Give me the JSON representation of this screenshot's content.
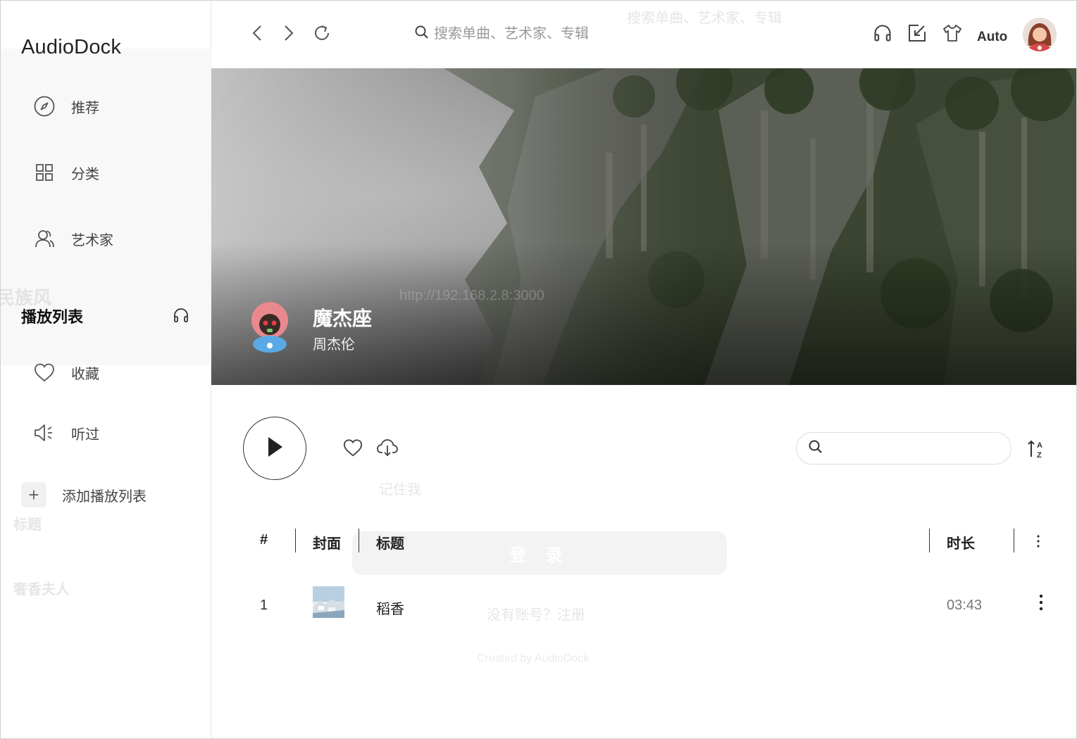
{
  "app": {
    "name": "AudioDock"
  },
  "sidebar": {
    "items": [
      {
        "label": "推荐",
        "icon": "compass-icon"
      },
      {
        "label": "分类",
        "icon": "grid-icon"
      },
      {
        "label": "艺术家",
        "icon": "users-icon"
      }
    ],
    "playlist_section": {
      "title": "播放列表",
      "icon": "headphones-icon"
    },
    "playlist_items": [
      {
        "label": "收藏",
        "icon": "heart-icon"
      },
      {
        "label": "听过",
        "icon": "speaker-icon"
      }
    ],
    "add_playlist_label": "添加播放列表",
    "ghost_texts": {
      "genre": "民族风",
      "title": "标题",
      "song": "奢香夫人"
    }
  },
  "topbar": {
    "search_placeholder": "搜索单曲、艺术家、专辑",
    "mode_label": "Auto",
    "icons": [
      "back-icon",
      "forward-icon",
      "refresh-icon",
      "headphones-icon",
      "mini-player-icon",
      "theme-shirt-icon"
    ]
  },
  "album": {
    "title": "魔杰座",
    "artist": "周杰伦"
  },
  "controls": {
    "icons": [
      "play-icon",
      "heart-icon",
      "cloud-download-icon",
      "search-icon",
      "sort-az-icon"
    ]
  },
  "table": {
    "headers": {
      "index": "#",
      "cover": "封面",
      "title": "标题",
      "duration": "时长"
    },
    "rows": [
      {
        "index": "1",
        "title": "稻香",
        "duration": "03:43"
      }
    ]
  },
  "ghost_login": {
    "url_placeholder": "http://192.168.2.8:3000",
    "remember": "记住我",
    "login": "登 录",
    "register": "没有账号？注册",
    "footer": "Created by AudioDock"
  }
}
